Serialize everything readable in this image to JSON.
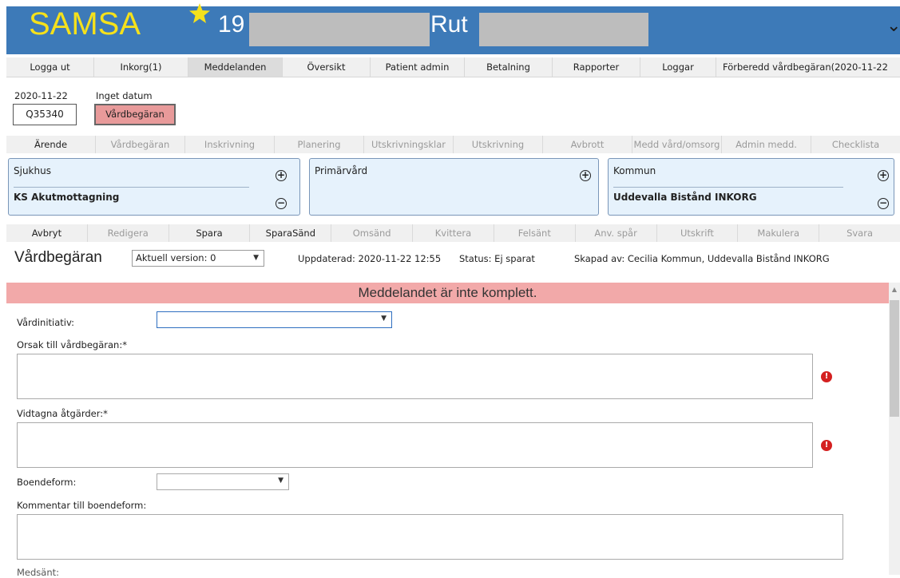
{
  "header": {
    "logo": "SAMSA",
    "patient_number": "19",
    "patient_name": "Rut"
  },
  "main_nav": [
    {
      "label": "Logga ut",
      "active": false
    },
    {
      "label": "Inkorg(1)",
      "active": false
    },
    {
      "label": "Meddelanden",
      "active": true
    },
    {
      "label": "Översikt",
      "active": false
    },
    {
      "label": "Patient admin",
      "active": false
    },
    {
      "label": "Betalning",
      "active": false
    },
    {
      "label": "Rapporter",
      "active": false
    },
    {
      "label": "Loggar",
      "active": false
    },
    {
      "label": "Förberedd vårdbegäran(2020-11-22",
      "active": false
    }
  ],
  "case": {
    "date": "2020-11-22",
    "no_date": "Inget datum",
    "case_id": "Q35340",
    "type_button": "Vårdbegäran"
  },
  "stage_tabs": [
    {
      "label": "Ärende",
      "enabled": true
    },
    {
      "label": "Vårdbegäran",
      "enabled": false
    },
    {
      "label": "Inskrivning",
      "enabled": false
    },
    {
      "label": "Planering",
      "enabled": false
    },
    {
      "label": "Utskrivningsklar",
      "enabled": false
    },
    {
      "label": "Utskrivning",
      "enabled": false
    },
    {
      "label": "Avbrott",
      "enabled": false
    },
    {
      "label": "Medd vård/omsorg",
      "enabled": false
    },
    {
      "label": "Admin medd.",
      "enabled": false
    },
    {
      "label": "Checklista",
      "enabled": false
    }
  ],
  "panels": {
    "sjukhus": {
      "title": "Sjukhus",
      "unit": "KS Akutmottagning"
    },
    "primarvard": {
      "title": "Primärvård"
    },
    "kommun": {
      "title": "Kommun",
      "unit": "Uddevalla Bistånd INKORG"
    }
  },
  "actions": [
    {
      "label": "Avbryt",
      "enabled": true
    },
    {
      "label": "Redigera",
      "enabled": false
    },
    {
      "label": "Spara",
      "enabled": true
    },
    {
      "label": "SparaSänd",
      "enabled": true
    },
    {
      "label": "Omsänd",
      "enabled": false
    },
    {
      "label": "Kvittera",
      "enabled": false
    },
    {
      "label": "Felsänt",
      "enabled": false
    },
    {
      "label": "Anv. spår",
      "enabled": false
    },
    {
      "label": "Utskrift",
      "enabled": false
    },
    {
      "label": "Makulera",
      "enabled": false
    },
    {
      "label": "Svara",
      "enabled": false
    }
  ],
  "info": {
    "title": "Vårdbegäran",
    "version": "Aktuell version: 0",
    "updated": "Uppdaterad: 2020-11-22 12:55",
    "status": "Status: Ej sparat",
    "created_by": "Skapad av: Cecilia Kommun, Uddevalla Bistånd INKORG"
  },
  "form": {
    "banner": "Meddelandet är inte komplett.",
    "vardinitiativ_label": "Vårdinitiativ:",
    "orsak_label": "Orsak till vårdbegäran:*",
    "atgarder_label": "Vidtagna åtgärder:*",
    "boendeform_label": "Boendeform:",
    "kommentar_label": "Kommentar till boendeform:",
    "medsant_label": "Medsänt:"
  },
  "colors": {
    "header_bg": "#3d7ab8",
    "logo": "#f5e11b",
    "banner": "#f2a9a9",
    "panel_bg": "#e6f2fc",
    "error": "#d42020"
  }
}
